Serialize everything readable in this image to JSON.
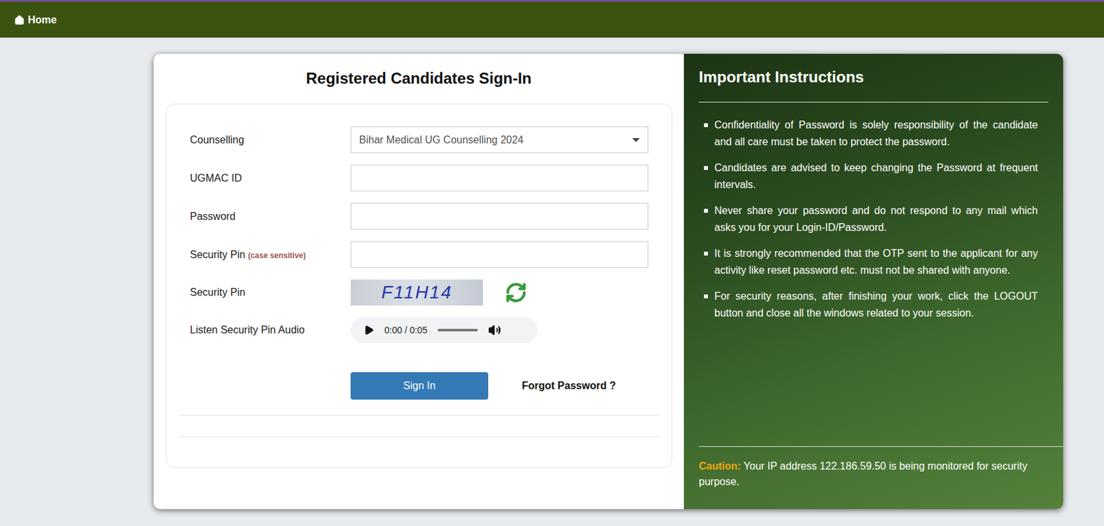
{
  "nav": {
    "home": "Home"
  },
  "form": {
    "title": "Registered Candidates Sign-In",
    "fields": [
      {
        "kind": "select",
        "label": "Counselling",
        "value": "Bihar Medical UG Counselling 2024"
      },
      {
        "kind": "text",
        "label": "UGMAC ID"
      },
      {
        "kind": "password",
        "label": "Password"
      },
      {
        "kind": "text",
        "label": "Security Pin",
        "hint": "(case sensitive)"
      },
      {
        "kind": "captcha",
        "label": "Security Pin",
        "captcha": "F11H14"
      },
      {
        "kind": "audio",
        "label": "Listen Security Pin Audio",
        "time": "0:00 / 0:05",
        "level": 0
      }
    ],
    "sign_in": "Sign In",
    "forgot": "Forgot Password ?"
  },
  "instructions": {
    "title": "Important Instructions",
    "items": [
      "Confidentiality of Password is solely responsibility of the candidate and all care must be taken to protect the password.",
      "Candidates are advised to keep changing the Password at frequent intervals.",
      "Never share your password and do not respond to any mail which asks you for your Login-ID/Password.",
      "It is strongly recommended that the OTP sent to the applicant for any activity like reset password etc. must not be shared with anyone.",
      "For security reasons, after finishing your work, click the LOGOUT button and close all the windows related to your session."
    ],
    "caution_label": "Caution:",
    "caution_text": "Your IP address 122.186.59.50 is being monitored for security purpose."
  }
}
